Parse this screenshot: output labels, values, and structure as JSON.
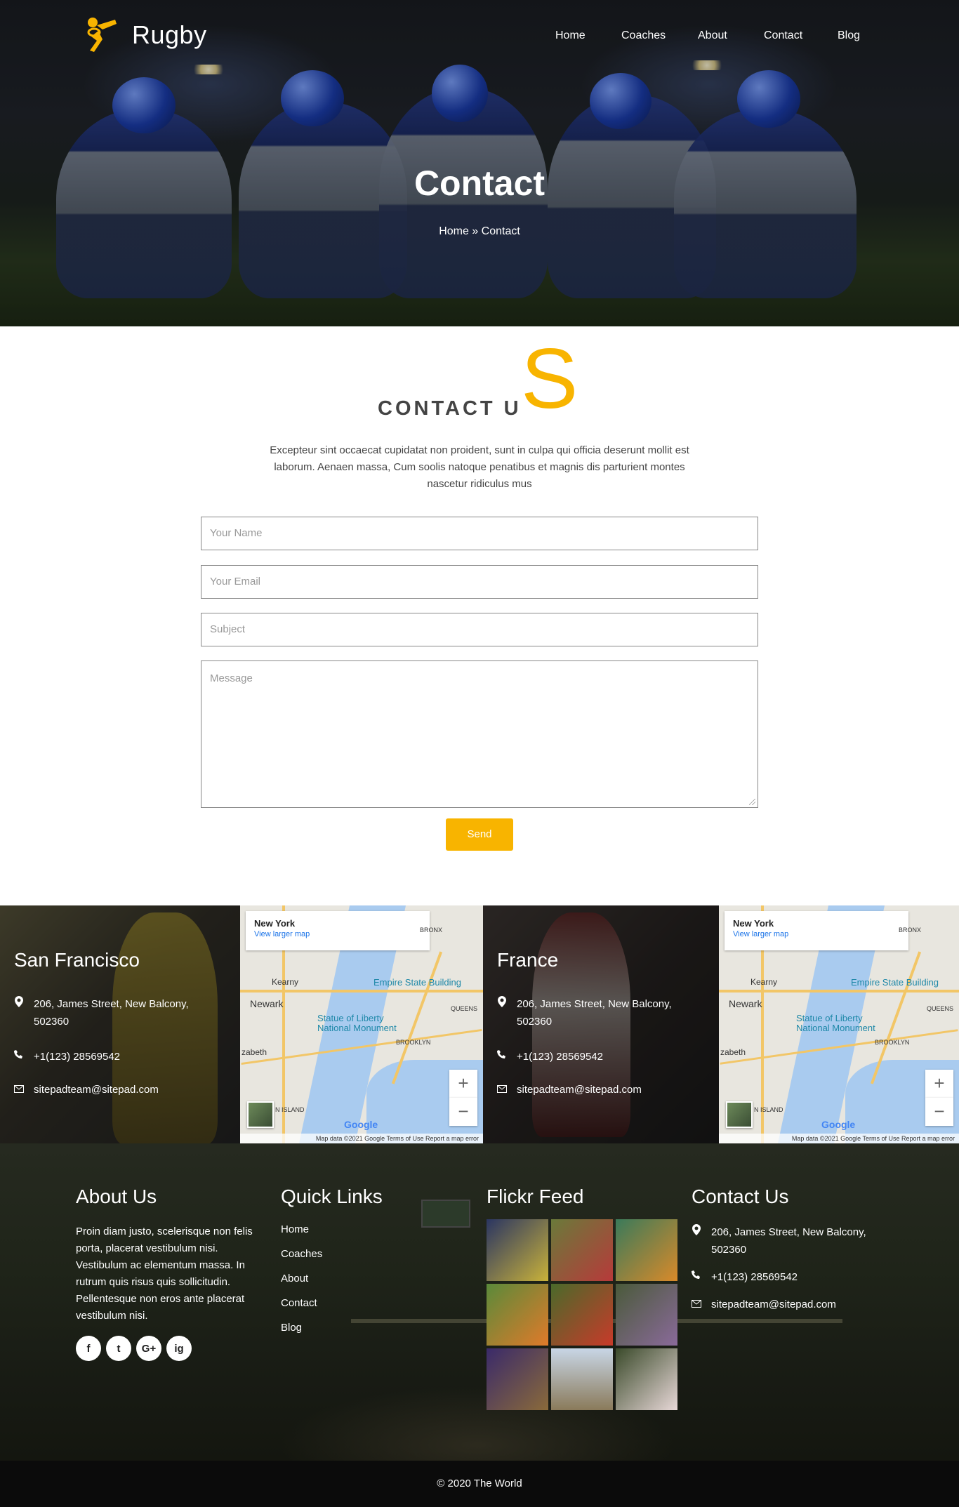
{
  "brand": {
    "name": "Rugby"
  },
  "nav": {
    "home": "Home",
    "coaches": "Coaches",
    "about": "About",
    "contact": "Contact",
    "blog": "Blog"
  },
  "hero": {
    "title": "Contact",
    "breadcrumb": "Home » Contact"
  },
  "contact_section": {
    "heading_small": "CONTACT U",
    "heading_big": "S",
    "intro": "Excepteur sint occaecat cupidatat non proident, sunt in culpa qui officia deserunt mollit est laborum. Aenaen massa, Cum soolis natoque penatibus et magnis dis parturient montes nascetur ridiculus mus",
    "form": {
      "name_placeholder": "Your Name",
      "email_placeholder": "Your Email",
      "subject_placeholder": "Subject",
      "message_placeholder": "Message",
      "send_label": "Send"
    }
  },
  "locations": [
    {
      "name": "San Francisco",
      "address": "206, James Street, New Balcony, 502360",
      "phone": "+1(123) 28569542",
      "email": "sitepadteam@sitepad.com"
    },
    {
      "name": "France",
      "address": "206, James Street, New Balcony, 502360",
      "phone": "+1(123) 28569542",
      "email": "sitepadteam@sitepad.com"
    }
  ],
  "map": {
    "place": "New York",
    "link": "View larger map",
    "poi_1": "Empire State Building",
    "poi_2": "Statue of Liberty National Monument",
    "label_newark": "Newark",
    "label_kearny": "Kearny",
    "label_brooklyn": "BROOKLYN",
    "label_queens": "QUEENS",
    "label_bronx": "BRONX",
    "label_elizabeth": "zabeth",
    "label_island": "N ISLAND",
    "zoom_in": "+",
    "zoom_out": "−",
    "google": "Google",
    "attribution": "Map data ©2021 Google    Terms of Use    Report a map error"
  },
  "footer": {
    "about_title": "About Us",
    "about_text": "Proin diam justo, scelerisque non felis porta, placerat vestibulum nisi. Vestibulum ac elementum massa. In rutrum quis risus quis sollicitudin. Pellentesque non eros ante placerat vestibulum nisi.",
    "social": [
      "f",
      "t",
      "G+",
      "ig"
    ],
    "links_title": "Quick Links",
    "links": [
      "Home",
      "Coaches",
      "About",
      "Contact",
      "Blog"
    ],
    "flickr_title": "Flickr Feed",
    "contact_title": "Contact Us",
    "contact_address": "206, James Street, New Balcony, 502360",
    "contact_phone": "+1(123) 28569542",
    "contact_email": "sitepadteam@sitepad.com"
  },
  "copyright": "© 2020 The World",
  "icons": {
    "location": "map-marker-icon",
    "phone": "phone-icon",
    "email": "envelope-icon"
  },
  "colors": {
    "accent": "#f8b400",
    "footer_bg": "#1f2419",
    "copyright_bg": "#0b0b0b"
  }
}
